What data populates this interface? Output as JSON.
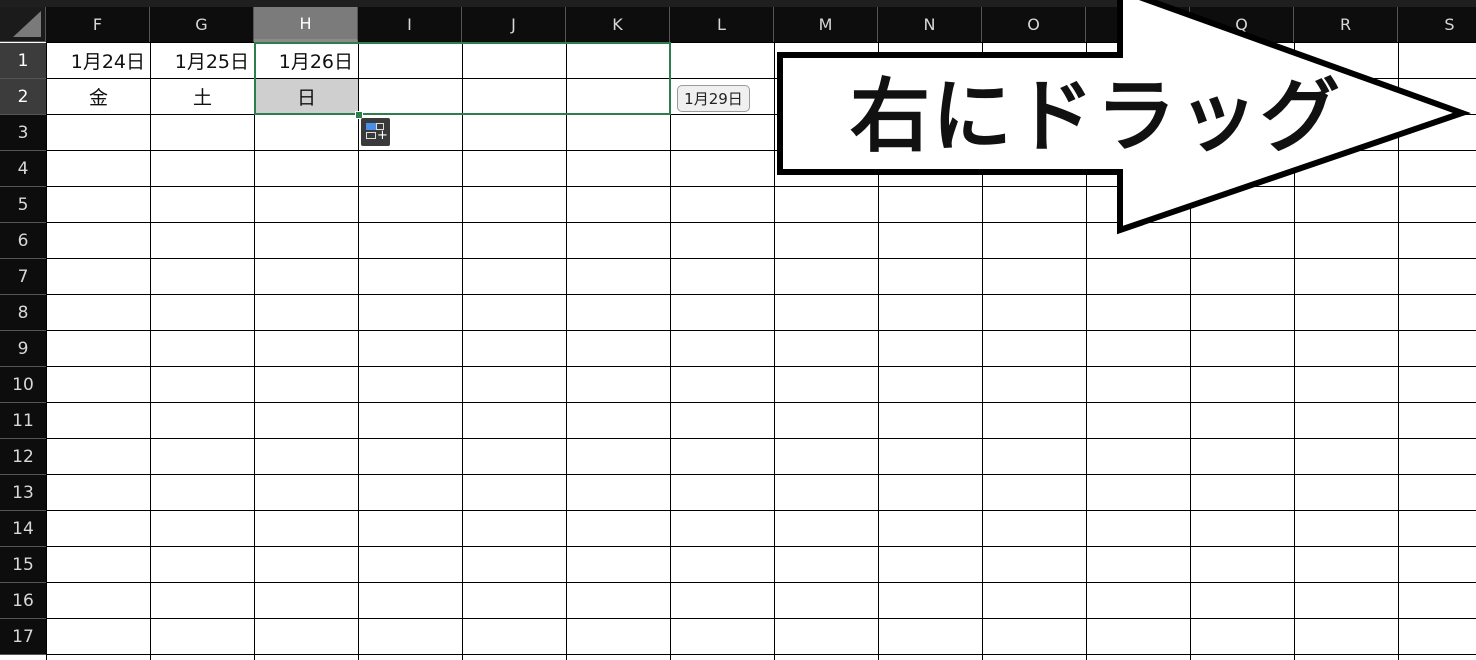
{
  "columns": [
    "F",
    "G",
    "H",
    "I",
    "J",
    "K",
    "L",
    "M",
    "N",
    "O",
    "P",
    "Q",
    "R",
    "S"
  ],
  "rows": [
    "1",
    "2",
    "3",
    "4",
    "5",
    "6",
    "7",
    "8",
    "9",
    "10",
    "11",
    "12",
    "13",
    "14",
    "15",
    "16",
    "17"
  ],
  "cells": {
    "F1": "1月24日",
    "G1": "1月25日",
    "H1": "1月26日",
    "F2": "金",
    "G2": "土",
    "H2": "日"
  },
  "fill_tooltip": "1月29日",
  "annotation_text": "右にドラッグ",
  "colors": {
    "header_bg": "#0d0d0d",
    "header_selected": "#7b7b7b",
    "selection_border": "#2e7d4f",
    "selected_cell_fill": "#cfcfcf"
  },
  "icons": [
    "autofill-options-icon",
    "select-all-corner-icon",
    "right-arrow-shape"
  ]
}
